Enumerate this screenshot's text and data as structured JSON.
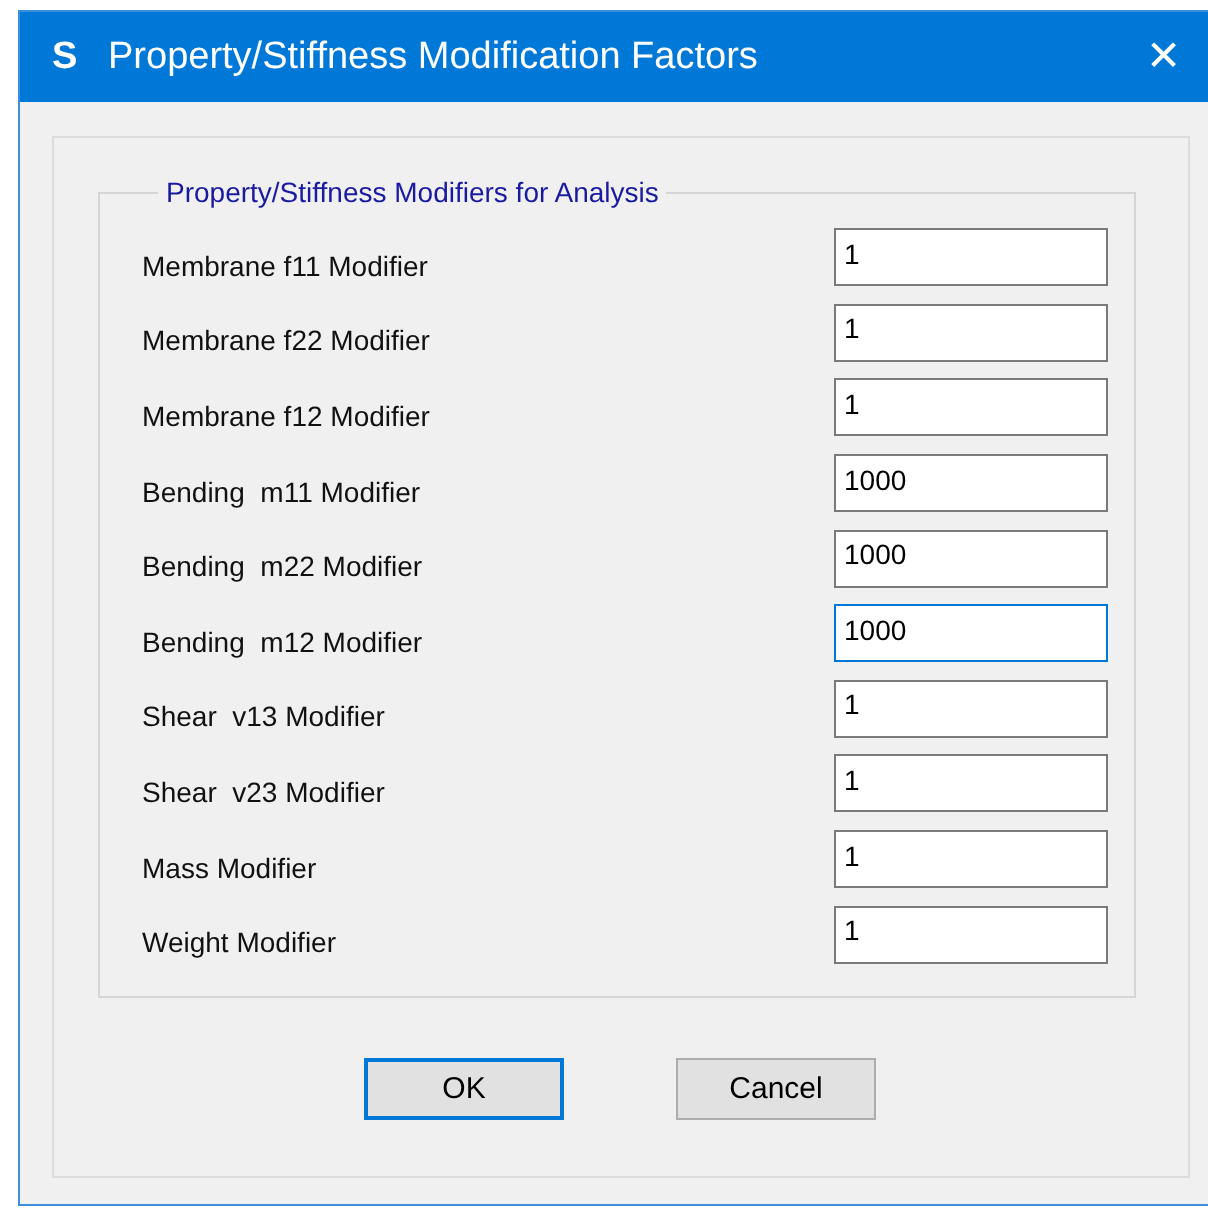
{
  "window": {
    "icon_letter": "S",
    "title": "Property/Stiffness Modification Factors",
    "close": "✕"
  },
  "group": {
    "title": "Property/Stiffness Modifiers for Analysis",
    "fields": [
      {
        "label": "Membrane f11 Modifier",
        "value": "1",
        "focused": false
      },
      {
        "label": "Membrane f22 Modifier",
        "value": "1",
        "focused": false
      },
      {
        "label": "Membrane f12 Modifier",
        "value": "1",
        "focused": false
      },
      {
        "label": "Bending  m11 Modifier",
        "value": "1000",
        "focused": false
      },
      {
        "label": "Bending  m22 Modifier",
        "value": "1000",
        "focused": false
      },
      {
        "label": "Bending  m12 Modifier",
        "value": "1000",
        "focused": true
      },
      {
        "label": "Shear  v13 Modifier",
        "value": "1",
        "focused": false
      },
      {
        "label": "Shear  v23 Modifier",
        "value": "1",
        "focused": false
      },
      {
        "label": "Mass Modifier",
        "value": "1",
        "focused": false
      },
      {
        "label": "Weight Modifier",
        "value": "1",
        "focused": false
      }
    ]
  },
  "buttons": [
    {
      "label": "OK",
      "default": true
    },
    {
      "label": "Cancel",
      "default": false
    }
  ]
}
